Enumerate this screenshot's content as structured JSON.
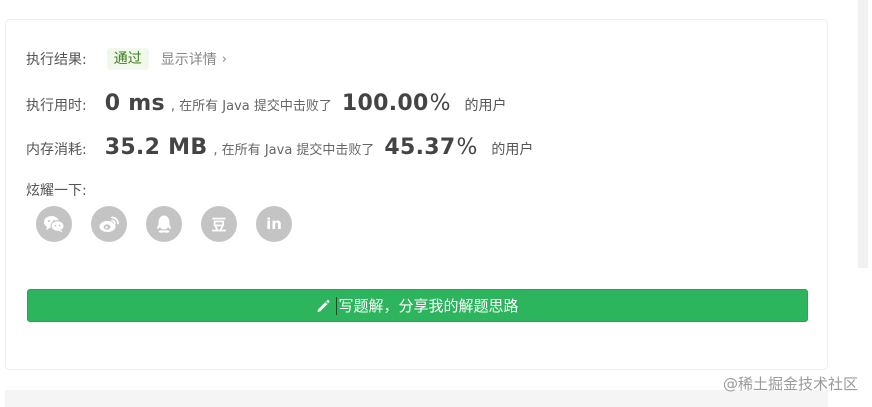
{
  "result": {
    "label": "执行结果:",
    "status": "通过",
    "details_link": "显示详情"
  },
  "runtime": {
    "label": "执行用时:",
    "value": "0 ms",
    "middle_text": ", 在所有 Java 提交中击败了",
    "percent": "100.00",
    "percent_unit": "%",
    "suffix": "的用户"
  },
  "memory": {
    "label": "内存消耗:",
    "value": "35.2 MB",
    "middle_text": ", 在所有 Java 提交中击败了",
    "percent": "45.37",
    "percent_unit": "%",
    "suffix": "的用户"
  },
  "share": {
    "label": "炫耀一下:",
    "icons": [
      "wechat-icon",
      "weibo-icon",
      "qq-icon",
      "douban-icon",
      "linkedin-icon"
    ],
    "douban_glyph": "豆",
    "linkedin_glyph": "in"
  },
  "write_button": {
    "label": "写题解，分享我的解题思路"
  },
  "watermark": "@稀土掘金技术社区",
  "colors": {
    "accent_green": "#2db55d",
    "badge_bg": "#f0f9eb",
    "icon_gray": "#c4c4c4"
  }
}
